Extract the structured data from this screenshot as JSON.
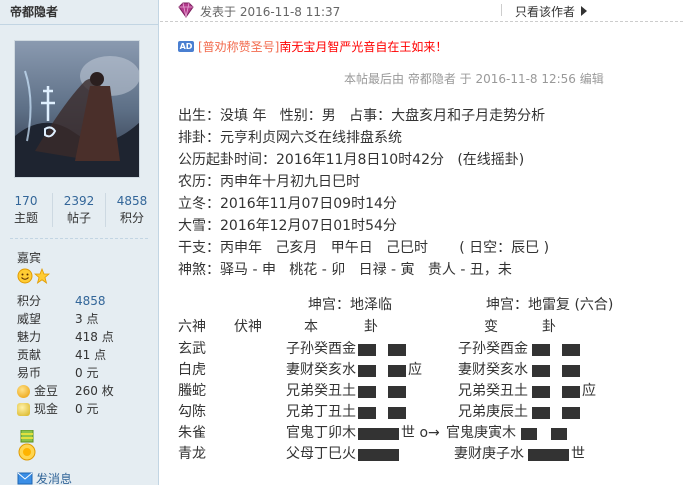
{
  "user": {
    "name": "帝都隐者",
    "stats": [
      {
        "value": "170",
        "label": "主题"
      },
      {
        "value": "2392",
        "label": "帖子"
      },
      {
        "value": "4858",
        "label": "积分"
      }
    ],
    "group": "嘉宾",
    "info": [
      {
        "key": "积分",
        "value": "4858",
        "link": true
      },
      {
        "key": "威望",
        "value": "3 点"
      },
      {
        "key": "魅力",
        "value": "418 点"
      },
      {
        "key": "贡献",
        "value": "41 点"
      },
      {
        "key": "易币",
        "value": "0 元"
      },
      {
        "key": "金豆",
        "value": "260 枚",
        "icon": "gold-coin-icon"
      },
      {
        "key": "现金",
        "value": "0 元",
        "icon": "cash-coin-icon"
      }
    ],
    "send_message": "发消息"
  },
  "post": {
    "time": "发表于 2016-11-8 11:37",
    "only_author": "只看该作者",
    "ad_badge": "AD",
    "ad_text_1": "[普劝称赞圣号]",
    "ad_text_2": "南无宝月智严光音自在王如来！",
    "edit_note": "本帖最后由 帝都隐者 于 2016-11-8 12:56 编辑",
    "lines": [
      "出生：没填 年   性别：男   占事：大盘亥月和子月走势分析",
      "排卦：元亨利贞网六爻在线排盘系统",
      "公历起卦时间：2016年11月8日10时42分   (在线摇卦)",
      "农历：丙申年十月初九日巳时",
      "立冬：2016年11月07日09时14分",
      "大雪：2016年12月07日01时54分",
      "干支：丙申年   己亥月   甲午日   己巳时       ( 日空：辰巳 )",
      "神煞：驿马 - 申   桃花 - 卯   日禄 - 寅   贵人 - 丑，未"
    ],
    "hexagram": {
      "main_title": "坤宫：地泽临",
      "changed_title": "坤宫：地雷复 (六合)",
      "col_liushen": "六神",
      "col_fushen": "伏神",
      "col_ben": "本",
      "col_gua": "卦",
      "col_bian": "变",
      "col_gua2": "卦",
      "rows": [
        {
          "shen": "玄武",
          "main": "子孙癸酉金",
          "changed": "子孙癸酉金",
          "mark": "",
          "cmark": ""
        },
        {
          "shen": "白虎",
          "main": "妻财癸亥水",
          "changed": "妻财癸亥水",
          "mark": "应",
          "cmark": ""
        },
        {
          "shen": "螣蛇",
          "main": "兄弟癸丑土",
          "changed": "兄弟癸丑土",
          "mark": "",
          "cmark": "应"
        },
        {
          "shen": "勾陈",
          "main": "兄弟丁丑土",
          "changed": "兄弟庚辰土",
          "mark": "",
          "cmark": ""
        },
        {
          "shen": "朱雀",
          "main": "官鬼丁卯木",
          "changed": "官鬼庚寅木",
          "mark": "世 o→",
          "cmark": ""
        },
        {
          "shen": "青龙",
          "main": "父母丁巳火",
          "changed": "妻财庚子水",
          "mark": "",
          "cmark": "世"
        }
      ]
    }
  },
  "colors": {
    "sidebar_bg": "#e5edf2",
    "link": "#336699",
    "ad_orange": "#f26c4f",
    "ad_red": "#ff0000"
  }
}
